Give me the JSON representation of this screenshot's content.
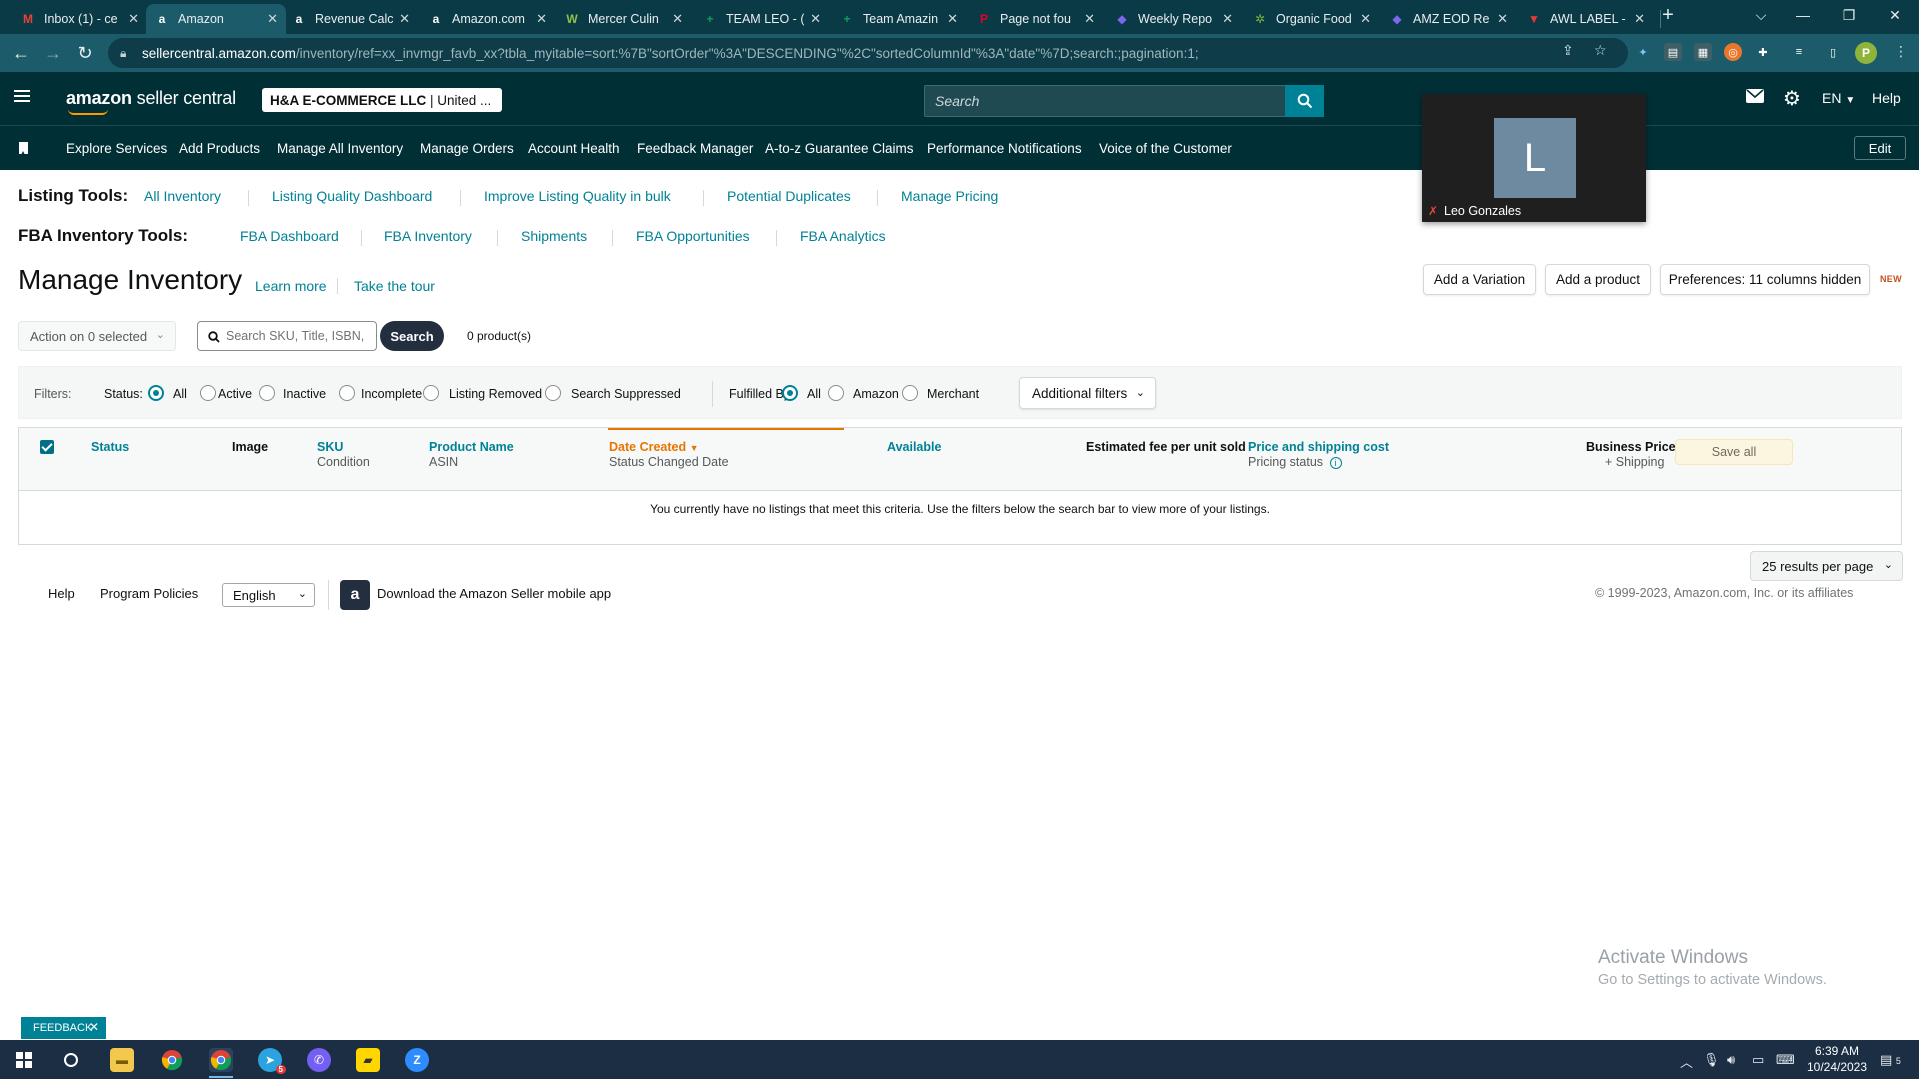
{
  "browser": {
    "tabs": [
      {
        "label": "Inbox (1) - ce",
        "icon": "gmail-icon",
        "color": "#ea4335",
        "glyph": "M"
      },
      {
        "label": "Amazon",
        "icon": "amazon-icon",
        "color": "#ffffff",
        "glyph": "a"
      },
      {
        "label": "Revenue Calc",
        "icon": "amazon-icon",
        "color": "#ffffff",
        "glyph": "a"
      },
      {
        "label": "Amazon.com",
        "icon": "amazon-icon",
        "color": "#ffffff",
        "glyph": "a"
      },
      {
        "label": "Mercer Culin",
        "icon": "mercer-icon",
        "color": "#8bc34a",
        "glyph": "W"
      },
      {
        "label": "TEAM LEO - (",
        "icon": "sheets-icon",
        "color": "#0f9d58",
        "glyph": "+"
      },
      {
        "label": "Team Amazin",
        "icon": "sheets-icon",
        "color": "#0f9d58",
        "glyph": "+"
      },
      {
        "label": "Page not fou",
        "icon": "pinterest-icon",
        "color": "#e60023",
        "glyph": "P"
      },
      {
        "label": "Weekly Repo",
        "icon": "clickup-icon",
        "color": "#7b68ee",
        "glyph": "◆"
      },
      {
        "label": "Organic Food",
        "icon": "leaf-icon",
        "color": "#7cb342",
        "glyph": "✲"
      },
      {
        "label": "AMZ EOD Re",
        "icon": "clickup-icon",
        "color": "#7b68ee",
        "glyph": "◆"
      },
      {
        "label": "AWL LABEL -",
        "icon": "awl-icon",
        "color": "#e53935",
        "glyph": "▼"
      }
    ],
    "url_host": "sellercentral.amazon.com",
    "url_path": "/inventory/ref=xx_invmgr_favb_xx?tbla_myitable=sort:%7B\"sortOrder\"%3A\"DESCENDING\"%2C\"sortedColumnId\"%3A\"date\"%7D;search:;pagination:1;",
    "profile_initial": "P"
  },
  "header": {
    "logo_main": "amazon",
    "logo_sub": "seller central",
    "account_name": "H&A E-COMMERCE LLC",
    "account_region": "United ...",
    "search_placeholder": "Search",
    "lang": "EN",
    "help": "Help"
  },
  "nav": {
    "items": [
      "Explore Services",
      "Add Products",
      "Manage All Inventory",
      "Manage Orders",
      "Account Health",
      "Feedback Manager",
      "A-to-z Guarantee Claims",
      "Performance Notifications",
      "Voice of the Customer"
    ],
    "edit": "Edit"
  },
  "listing_tools": {
    "label": "Listing Tools:",
    "links": [
      "All Inventory",
      "Listing Quality Dashboard",
      "Improve Listing Quality in bulk",
      "Potential Duplicates",
      "Manage Pricing"
    ]
  },
  "fba_tools": {
    "label": "FBA Inventory Tools:",
    "links": [
      "FBA Dashboard",
      "FBA Inventory",
      "Shipments",
      "FBA Opportunities",
      "FBA Analytics"
    ]
  },
  "page": {
    "title": "Manage Inventory",
    "learn_more": "Learn more",
    "take_tour": "Take the tour",
    "add_variation": "Add a Variation",
    "add_product": "Add a product",
    "preferences": "Preferences: 11 columns hidden",
    "new_badge": "NEW"
  },
  "actions": {
    "action_dropdown": "Action on 0 selected",
    "search_placeholder": "Search SKU, Title, ISBN,",
    "search_button": "Search",
    "product_count": "0 product(s)"
  },
  "filters": {
    "label": "Filters:",
    "status_label": "Status:",
    "status_options": [
      "All",
      "Active",
      "Inactive",
      "Incomplete",
      "Listing Removed",
      "Search Suppressed"
    ],
    "status_selected": "All",
    "fulfilled_label": "Fulfilled By:",
    "fulfilled_options": [
      "All",
      "Amazon",
      "Merchant"
    ],
    "fulfilled_selected": "All",
    "additional": "Additional filters"
  },
  "table": {
    "columns": {
      "status": "Status",
      "image": "Image",
      "sku": "SKU",
      "condition": "Condition",
      "product_name": "Product Name",
      "asin": "ASIN",
      "date_created": "Date Created",
      "status_changed": "Status Changed Date",
      "available": "Available",
      "fee": "Estimated fee per unit sold",
      "price_shipping": "Price and shipping cost",
      "pricing_status": "Pricing status",
      "business_price": "Business Price",
      "plus_shipping": "+ Shipping"
    },
    "save_all": "Save all",
    "empty_message": "You currently have no listings that meet this criteria. Use the filters below the search bar to view more of your listings.",
    "results_per_page": "25 results per page"
  },
  "footer": {
    "help": "Help",
    "policies": "Program Policies",
    "language": "English",
    "app": "Download the Amazon Seller mobile app",
    "copyright": "© 1999-2023, Amazon.com, Inc. or its affiliates"
  },
  "video": {
    "initial": "L",
    "name": "Leo Gonzales"
  },
  "watermark": {
    "line1": "Activate Windows",
    "line2": "Go to Settings to activate Windows."
  },
  "feedback": "FEEDBACK",
  "taskbar": {
    "time": "6:39 AM",
    "date": "10/24/2023",
    "notifications": "5",
    "telegram_badge": "5"
  },
  "colors": {
    "brand_dark": "#002f36",
    "link": "#008296",
    "sort_accent": "#e77600"
  }
}
